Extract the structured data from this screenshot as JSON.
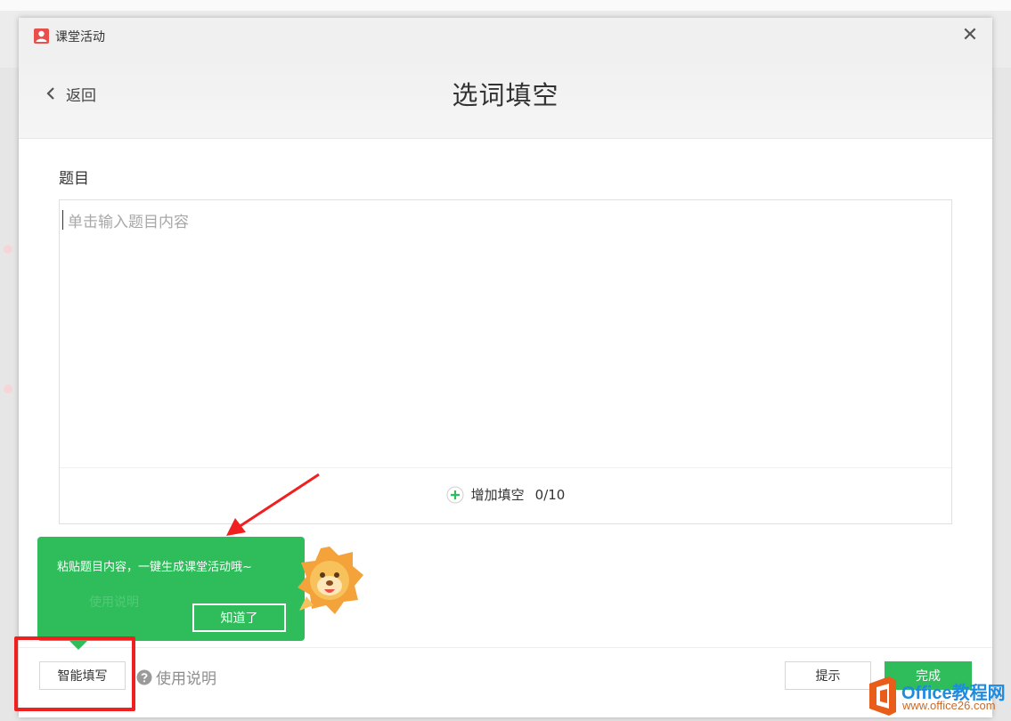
{
  "window": {
    "title": "课堂活动",
    "close_glyph": "✕"
  },
  "header": {
    "back_label": "返回",
    "page_title": "选词填空"
  },
  "question": {
    "label": "题目",
    "placeholder": "单击输入题目内容",
    "add_blank_label": "增加填空",
    "blank_count": "0/10"
  },
  "footer": {
    "smart_fill_label": "智能填写",
    "help_label": "使用说明",
    "hint_label": "提示",
    "done_label": "完成"
  },
  "tooltip": {
    "message": "粘贴题目内容，一键生成课堂活动哦~",
    "ok_label": "知道了"
  },
  "watermark": {
    "brand": "Office教程网",
    "url": "www.office26.com"
  },
  "colors": {
    "accent_green": "#2ebd5a",
    "annotation_red": "#f02020",
    "app_icon_red": "#e8504c"
  },
  "icons": {
    "app": "user-icon",
    "close": "close-icon",
    "back": "chevron-left-icon",
    "add": "plus-circle-icon",
    "help": "question-circle-icon"
  }
}
